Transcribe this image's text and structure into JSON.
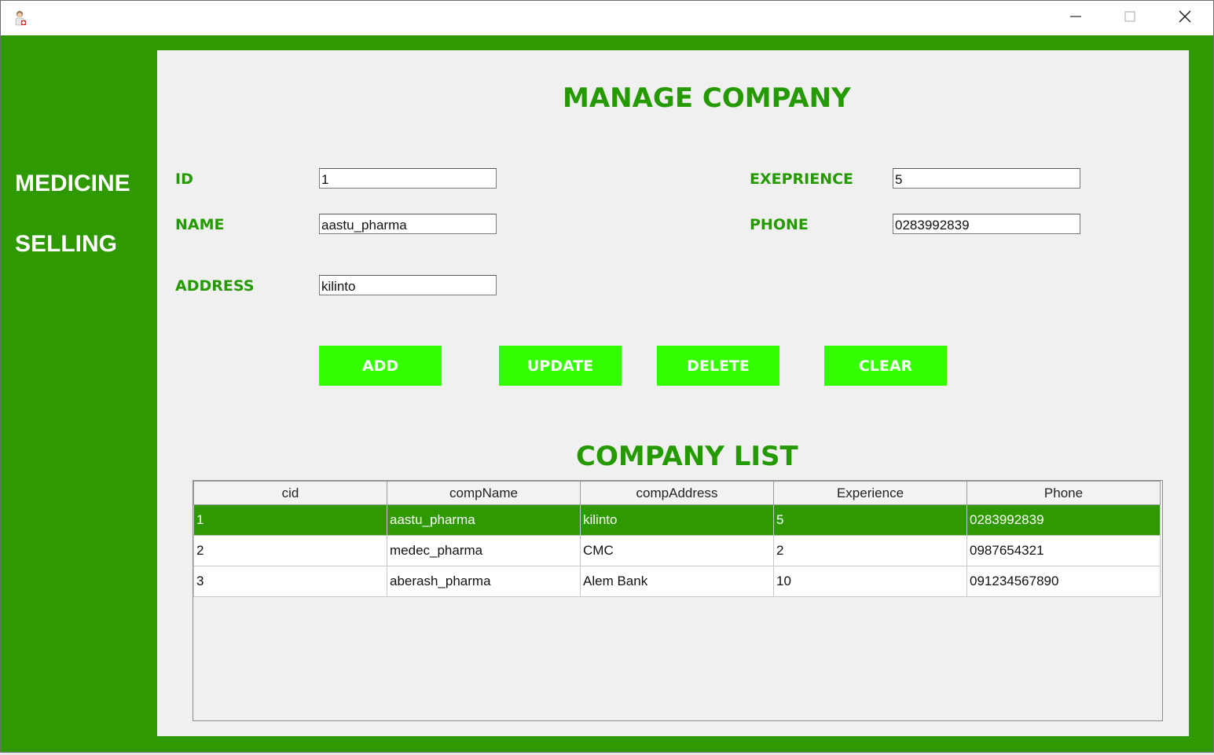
{
  "titlebar": {
    "app_icon": "doctor-icon",
    "minimize_icon": "minimize-icon",
    "maximize_icon": "maximize-icon",
    "close_icon": "close-icon"
  },
  "sidebar": {
    "line1": "MEDICINE",
    "line2": "SELLING"
  },
  "form": {
    "title": "MANAGE COMPANY",
    "id_label": "ID",
    "id_value": "1",
    "name_label": "NAME",
    "name_value": "aastu_pharma",
    "address_label": "ADDRESS",
    "address_value": "kilinto",
    "experience_label": "EXEPRIENCE",
    "experience_value": "5",
    "phone_label": "PHONE",
    "phone_value": "0283992839"
  },
  "buttons": {
    "add": "ADD",
    "update": "UPDATE",
    "delete": "DELETE",
    "clear": "CLEAR"
  },
  "list": {
    "title": "COMPANY LIST",
    "columns": [
      "cid",
      "compName",
      "compAddress",
      "Experience",
      "Phone"
    ],
    "rows": [
      [
        "1",
        "aastu_pharma",
        "kilinto",
        "5",
        "0283992839"
      ],
      [
        "2",
        "medec_pharma",
        "CMC",
        "2",
        "0987654321"
      ],
      [
        "3",
        "aberash_pharma",
        "Alem Bank",
        "10",
        "091234567890"
      ]
    ],
    "selected_row": 0
  },
  "colors": {
    "brand_green": "#2e9900",
    "label_green": "#249a00",
    "button_green": "#33ff00"
  }
}
